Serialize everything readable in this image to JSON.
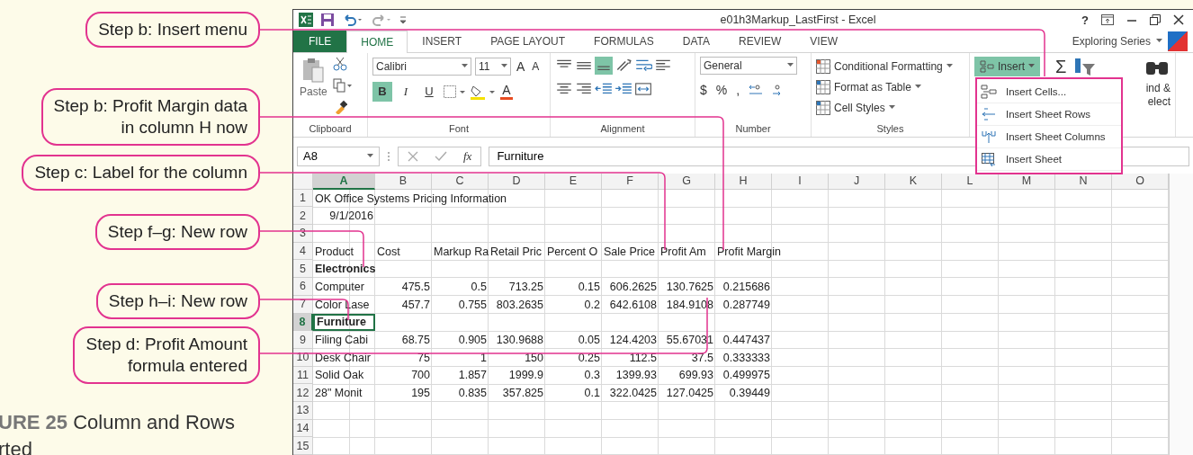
{
  "callouts": [
    {
      "text": "Step b: Insert menu"
    },
    {
      "text": "Step b: Profit Margin data\nin column H now"
    },
    {
      "text": "Step c: Label for the column"
    },
    {
      "text": "Step f–g: New row"
    },
    {
      "text": "Step h–i: New row"
    },
    {
      "text": "Step d: Profit Amount\nformula entered"
    }
  ],
  "caption": "**URE 25** Column and Rows rted",
  "window": {
    "title": "e01h3Markup_LastFirst - Excel",
    "help": "?"
  },
  "tabs": [
    {
      "label": "FILE",
      "kind": "file",
      "selected": false
    },
    {
      "label": "HOME",
      "kind": "tab",
      "selected": true
    },
    {
      "label": "INSERT",
      "kind": "tab",
      "selected": false
    },
    {
      "label": "PAGE LAYOUT",
      "kind": "tab",
      "selected": false
    },
    {
      "label": "FORMULAS",
      "kind": "tab",
      "selected": false
    },
    {
      "label": "DATA",
      "kind": "tab",
      "selected": false
    },
    {
      "label": "REVIEW",
      "kind": "tab",
      "selected": false
    },
    {
      "label": "VIEW",
      "kind": "tab",
      "selected": false
    }
  ],
  "account": "Exploring Series",
  "ribbon": {
    "clipboard": {
      "label": "Clipboard",
      "paste": "Paste"
    },
    "font": {
      "label": "Font",
      "name": "Calibri",
      "size": "11",
      "grow": "A",
      "shrink": "A",
      "color_letter": "A",
      "buttons": [
        {
          "label": "B",
          "on": true
        },
        {
          "label": "I",
          "on": false
        },
        {
          "label": "U",
          "on": false
        }
      ]
    },
    "alignment": {
      "label": "Alignment",
      "buttons": [
        {
          "kind": "top",
          "on": false
        },
        {
          "kind": "middle",
          "on": false
        },
        {
          "kind": "bottom",
          "on": true
        },
        {
          "kind": "orient",
          "on": false
        },
        {
          "kind": "wrap",
          "on": false
        },
        {
          "kind": "left",
          "on": false
        },
        {
          "kind": "center",
          "on": false
        },
        {
          "kind": "right",
          "on": false
        },
        {
          "kind": "outdent",
          "on": false
        },
        {
          "kind": "indent",
          "on": false
        },
        {
          "kind": "merge",
          "on": false
        }
      ]
    },
    "number": {
      "label": "Number",
      "format": "General",
      "symbols": [
        "$",
        "%",
        ","
      ]
    },
    "styles": {
      "label": "Styles",
      "items": [
        "Conditional Formatting",
        "Format as Table",
        "Cell Styles"
      ]
    },
    "cells": {
      "insert": "Insert",
      "expanded": true
    },
    "editing": {
      "sum": "Σ",
      "find": "ind &",
      "select": "elect"
    }
  },
  "insert_menu": [
    "Insert Cells...",
    "Insert Sheet Rows",
    "Insert Sheet Columns",
    "Insert Sheet"
  ],
  "formula_bar": {
    "name_box": "A8",
    "fx": "fx",
    "value": "Furniture"
  },
  "sheet": {
    "columns": [
      {
        "label": "A",
        "selected": true
      },
      {
        "label": "B",
        "selected": false
      },
      {
        "label": "C",
        "selected": false
      },
      {
        "label": "D",
        "selected": false
      },
      {
        "label": "E",
        "selected": false
      },
      {
        "label": "F",
        "selected": false
      },
      {
        "label": "G",
        "selected": false
      },
      {
        "label": "H",
        "selected": false
      },
      {
        "label": "I",
        "selected": false
      },
      {
        "label": "J",
        "selected": false
      },
      {
        "label": "K",
        "selected": false
      },
      {
        "label": "L",
        "selected": false
      },
      {
        "label": "M",
        "selected": false
      },
      {
        "label": "N",
        "selected": false
      },
      {
        "label": "O",
        "selected": false
      }
    ],
    "rows": [
      {
        "label": "1",
        "kind": "title",
        "selected": false,
        "cells": [
          "OK Office Systems Pricing Information"
        ]
      },
      {
        "label": "2",
        "kind": "date",
        "selected": false,
        "cells": [
          "9/1/2016"
        ]
      },
      {
        "label": "3",
        "kind": "empty",
        "selected": false
      },
      {
        "label": "4",
        "kind": "header",
        "selected": false,
        "cells": [
          "Product",
          "Cost",
          "Markup Ra",
          "Retail Pric",
          "Percent O",
          "Sale Price",
          "Profit Am",
          "Profit Margin"
        ]
      },
      {
        "label": "5",
        "kind": "category",
        "selected": false,
        "cells": [
          "Electronics"
        ]
      },
      {
        "label": "6",
        "kind": "data",
        "selected": false,
        "cells": [
          "Computer",
          "475.5",
          "0.5",
          "713.25",
          "0.15",
          "606.2625",
          "130.7625",
          "0.215686"
        ]
      },
      {
        "label": "7",
        "kind": "data",
        "selected": false,
        "cells": [
          "Color Lase",
          "457.7",
          "0.755",
          "803.2635",
          "0.2",
          "642.6108",
          "184.9108",
          "0.287749"
        ]
      },
      {
        "label": "8",
        "kind": "category",
        "selected": true,
        "cells": [
          "Furniture"
        ]
      },
      {
        "label": "9",
        "kind": "data",
        "selected": false,
        "cells": [
          "Filing Cabi",
          "68.75",
          "0.905",
          "130.9688",
          "0.05",
          "124.4203",
          "55.67031",
          "0.447437"
        ]
      },
      {
        "label": "10",
        "kind": "data",
        "selected": false,
        "cells": [
          "Desk Chair",
          "75",
          "1",
          "150",
          "0.25",
          "112.5",
          "37.5",
          "0.333333"
        ]
      },
      {
        "label": "11",
        "kind": "data",
        "selected": false,
        "cells": [
          "Solid Oak",
          "700",
          "1.857",
          "1999.9",
          "0.3",
          "1399.93",
          "699.93",
          "0.499975"
        ]
      },
      {
        "label": "12",
        "kind": "data",
        "selected": false,
        "cells": [
          "28\" Monit",
          "195",
          "0.835",
          "357.825",
          "0.1",
          "322.0425",
          "127.0425",
          "0.39449"
        ]
      },
      {
        "label": "13",
        "kind": "empty",
        "selected": false
      },
      {
        "label": "14",
        "kind": "empty",
        "selected": false
      },
      {
        "label": "15",
        "kind": "empty",
        "selected": false
      }
    ]
  }
}
